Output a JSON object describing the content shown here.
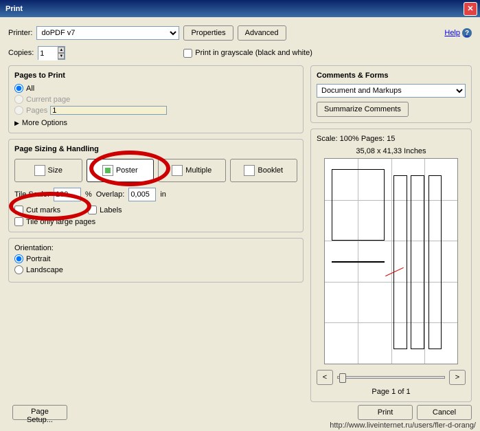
{
  "title": "Print",
  "printer_label": "Printer:",
  "printer_value": "doPDF v7",
  "properties_btn": "Properties",
  "advanced_btn": "Advanced",
  "help_label": "Help",
  "copies_label": "Copies:",
  "copies_value": "1",
  "grayscale_label": "Print in grayscale (black and white)",
  "pages_to_print": {
    "title": "Pages to Print",
    "all": "All",
    "current": "Current page",
    "pages": "Pages",
    "pages_value": "1",
    "more": "More Options"
  },
  "sizing": {
    "title": "Page Sizing & Handling",
    "size": "Size",
    "poster": "Poster",
    "multiple": "Multiple",
    "booklet": "Booklet",
    "tile_scale": "Tile Scale:",
    "tile_scale_val": "100",
    "pct": "%",
    "overlap": "Overlap:",
    "overlap_val": "0,005",
    "unit": "in",
    "cutmarks": "Cut marks",
    "labels": "Labels",
    "tile_only": "Tile only large pages"
  },
  "orientation": {
    "title": "Orientation:",
    "portrait": "Portrait",
    "landscape": "Landscape"
  },
  "comments": {
    "title": "Comments & Forms",
    "value": "Document and Markups",
    "summarize": "Summarize Comments"
  },
  "preview": {
    "scale": "Scale: 100% Pages: 15",
    "dims": "35,08 x 41,33 Inches",
    "prev": "<",
    "next": ">",
    "page": "Page 1 of 1"
  },
  "page_setup": "Page Setup...",
  "print_btn": "Print",
  "cancel_btn": "Cancel",
  "footer_url": "http://www.liveinternet.ru/users/fler-d-orang/"
}
